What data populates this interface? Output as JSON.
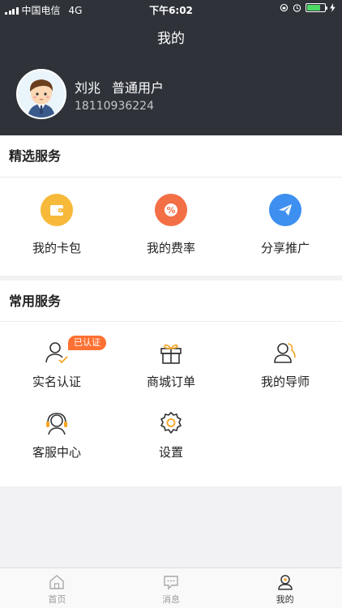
{
  "status_bar": {
    "carrier": "中国电信",
    "network": "4G",
    "time": "下午6:02",
    "battery_level": 0.75
  },
  "nav": {
    "title": "我的"
  },
  "user": {
    "name": "刘兆",
    "role": "普通用户",
    "phone": "18110936224"
  },
  "featured": {
    "title": "精选服务",
    "items": [
      {
        "label": "我的卡包",
        "icon": "wallet-icon",
        "color": "#f7b93a"
      },
      {
        "label": "我的费率",
        "icon": "percent-icon",
        "color": "#f36f45"
      },
      {
        "label": "分享推广",
        "icon": "paper-plane-icon",
        "color": "#3d8ff0"
      }
    ]
  },
  "common": {
    "title": "常用服务",
    "badge": "已认证",
    "items": [
      {
        "label": "实名认证",
        "icon": "user-verified-icon"
      },
      {
        "label": "商城订单",
        "icon": "gift-icon"
      },
      {
        "label": "我的导师",
        "icon": "mentor-icon"
      },
      {
        "label": "客服中心",
        "icon": "headset-icon"
      },
      {
        "label": "设置",
        "icon": "settings-gear-icon"
      }
    ]
  },
  "tabbar": {
    "tabs": [
      {
        "label": "首页",
        "icon": "home-icon",
        "active": false
      },
      {
        "label": "消息",
        "icon": "message-icon",
        "active": false
      },
      {
        "label": "我的",
        "icon": "profile-icon",
        "active": true
      }
    ]
  },
  "colors": {
    "header_bg": "#2f3339",
    "accent": "#f5a524",
    "badge": "#ff7133"
  }
}
